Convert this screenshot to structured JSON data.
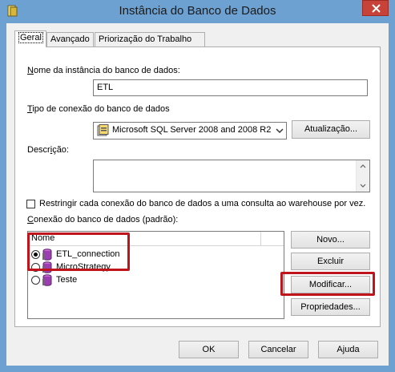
{
  "window": {
    "title": "Instância do Banco de Dados"
  },
  "tabs": [
    {
      "label": "Geral",
      "active": true
    },
    {
      "label": "Avançado",
      "active": false
    },
    {
      "label": "Priorização do Trabalho",
      "active": false
    }
  ],
  "instance_name": {
    "label_prefix": "N",
    "label_rest": "ome da instância do banco de dados:",
    "value": "ETL"
  },
  "connection_type": {
    "label_prefix": "T",
    "label_rest": "ipo de conexão do banco de dados",
    "selected": "Microsoft SQL Server 2008 and 2008 R2",
    "update_button": "Atualização..."
  },
  "description": {
    "label_pre": "Descr",
    "label_u": "i",
    "label_post": "ção:",
    "value": ""
  },
  "restrict_checkbox": {
    "label": "Restringir cada conexão do banco de dados a uma consulta ao warehouse por vez.",
    "checked": false
  },
  "default_connection": {
    "label_prefix": "C",
    "label_rest": "onexão do banco de dados (padrão):",
    "column_header": "Nome",
    "items": [
      {
        "name": "ETL_connection",
        "selected": true
      },
      {
        "name": "MicroStrategy",
        "selected": false
      },
      {
        "name": "Teste",
        "selected": false
      }
    ],
    "buttons": {
      "new": "Novo...",
      "delete": "Excluir",
      "modify": "Modificar...",
      "properties": "Propriedades..."
    }
  },
  "footer_buttons": {
    "ok": "OK",
    "cancel": "Cancelar",
    "help": "Ajuda"
  },
  "colors": {
    "titlebar": "#6da1d1",
    "highlight": "#c0141c",
    "close": "#c7433a"
  },
  "icons": [
    "app-icon",
    "close-icon",
    "database-icon",
    "chevron-down-icon"
  ]
}
